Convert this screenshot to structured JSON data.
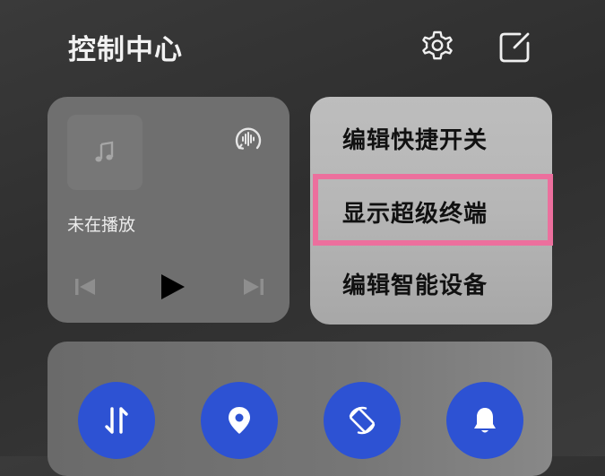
{
  "header": {
    "title": "控制中心",
    "settings_icon": "gear-icon",
    "edit_icon": "edit-square-icon"
  },
  "media": {
    "status": "未在播放",
    "album_icon": "music-note-icon",
    "output_icon": "audio-output-icon",
    "controls": [
      "skip-previous-icon",
      "play-icon",
      "skip-next-icon"
    ]
  },
  "menu": {
    "items": [
      {
        "label": "编辑快捷开关"
      },
      {
        "label": "显示超级终端"
      },
      {
        "label": "编辑智能设备"
      }
    ],
    "highlight_color": "#ec6f9d"
  },
  "toggles": {
    "accent_color": "#2d52d3",
    "items": [
      {
        "icon": "mobile-data-icon"
      },
      {
        "icon": "location-pin-icon"
      },
      {
        "icon": "auto-rotate-icon"
      },
      {
        "icon": "bell-icon"
      }
    ]
  }
}
